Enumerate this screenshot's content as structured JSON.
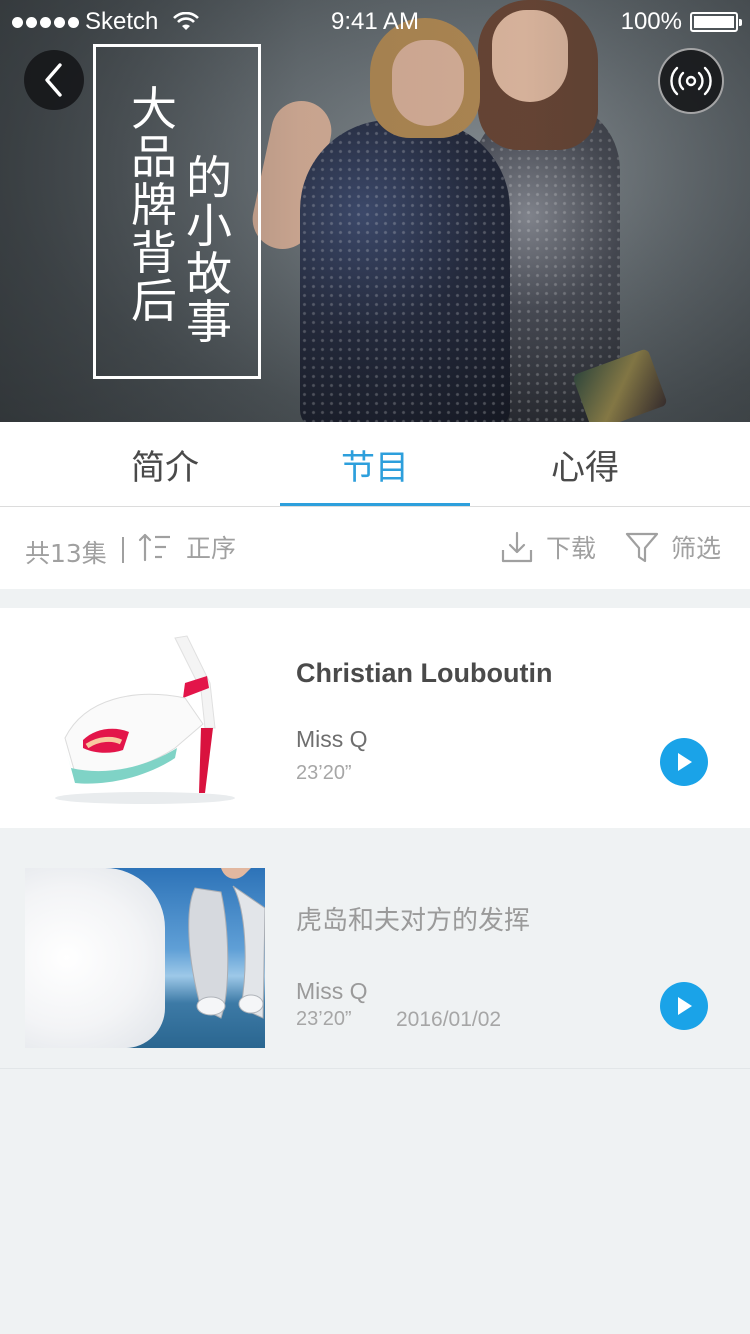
{
  "status_bar": {
    "carrier": "Sketch",
    "time": "9:41 AM",
    "battery": "100%"
  },
  "hero": {
    "title_col1": "大品牌背后",
    "title_col2": "的小故事",
    "back_icon": "chevron-left-icon",
    "broadcast_icon": "broadcast-icon"
  },
  "tabs": [
    {
      "label": "简介",
      "active": false
    },
    {
      "label": "节目",
      "active": true
    },
    {
      "label": "心得",
      "active": false
    }
  ],
  "toolbar": {
    "count": "共13集",
    "sort_label": "正序",
    "download_label": "下载",
    "filter_label": "筛选"
  },
  "episodes": [
    {
      "title": "Christian Louboutin",
      "author": "Miss Q",
      "duration": "23’20”",
      "date": ""
    },
    {
      "title": "虎岛和夫对方的发挥",
      "author": "Miss Q",
      "duration": "23’20”",
      "date": "2016/01/02"
    }
  ],
  "colors": {
    "accent": "#2d9fdc",
    "play": "#1aa3e8",
    "background": "#eff2f3"
  }
}
